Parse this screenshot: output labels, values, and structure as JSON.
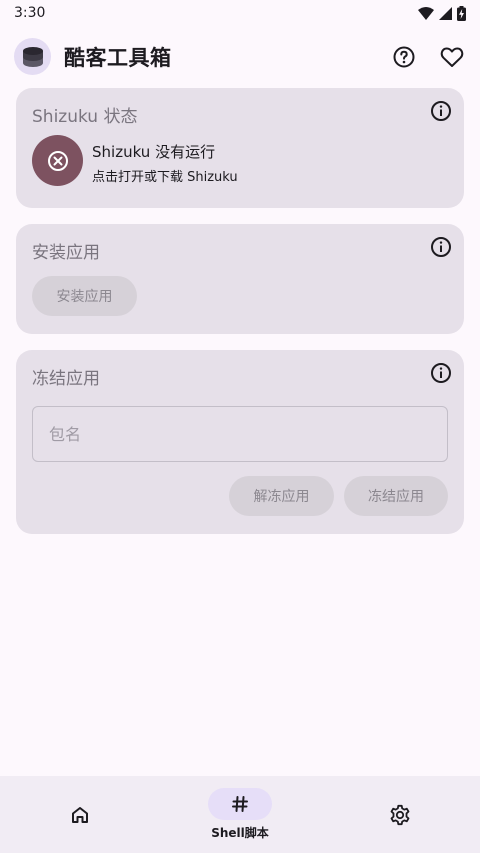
{
  "status_bar": {
    "time": "3:30"
  },
  "app_bar": {
    "title": "酷客工具箱"
  },
  "shizuku_card": {
    "title": "Shizuku 状态",
    "status_text": "Shizuku 没有运行",
    "hint_text": "点击打开或下载 Shizuku"
  },
  "install_card": {
    "title": "安装应用",
    "button_label": "安装应用"
  },
  "freeze_card": {
    "title": "冻结应用",
    "input_placeholder": "包名",
    "input_value": "",
    "unfreeze_label": "解冻应用",
    "freeze_label": "冻结应用"
  },
  "bottom_nav": {
    "items": [
      {
        "icon": "home-icon",
        "label": ""
      },
      {
        "icon": "hash-icon",
        "label": "Shell脚本",
        "selected": true
      },
      {
        "icon": "gear-icon",
        "label": ""
      }
    ]
  },
  "colors": {
    "background": "#fdf8fd",
    "card": "#e6e0e9",
    "error_circle": "#7d5260",
    "nav_background": "#f1ecf4",
    "nav_indicator": "#e6def8"
  }
}
